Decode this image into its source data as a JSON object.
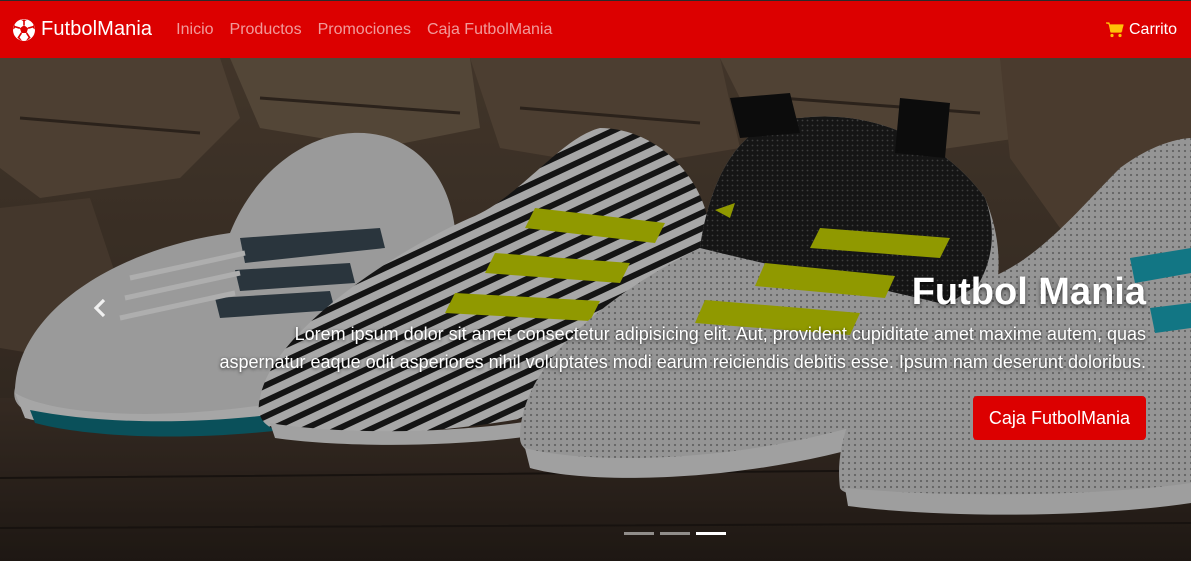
{
  "navbar": {
    "brand": "FutbolMania",
    "brand_icon": "soccer-ball-icon",
    "links": [
      "Inicio",
      "Productos",
      "Promociones",
      "Caja FutbolMania"
    ],
    "cart_label": "Carrito",
    "cart_icon": "shopping-cart-icon",
    "background_color": "#dc0000",
    "cart_icon_color": "#ffc107"
  },
  "carousel": {
    "title": "Futbol Mania",
    "text": "Lorem ipsum dolor sit amet consectetur adipisicing elit. Aut, provident cupiditate amet maxime autem, quas aspernatur eaque odit asperiores nihil voluptates modi earum reiciendis debitis esse. Ipsum nam deserunt doloribus.",
    "button_label": "Caja FutbolMania",
    "prev_icon": "chevron-left-icon",
    "indicator_count": 3,
    "active_indicator": 3
  }
}
